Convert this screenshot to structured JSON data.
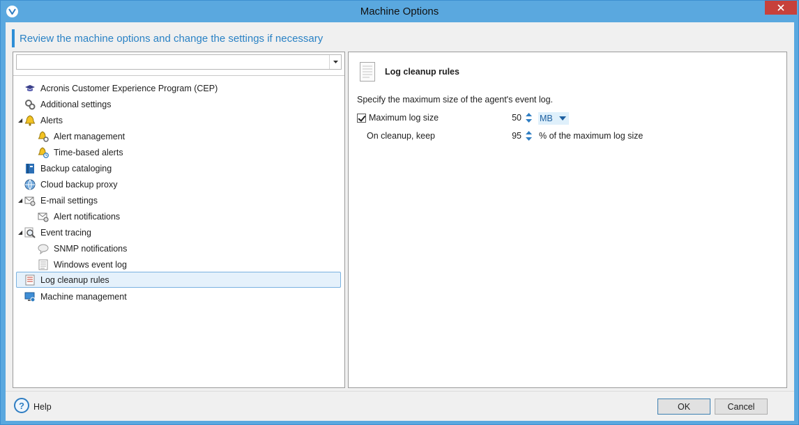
{
  "window": {
    "title": "Machine Options"
  },
  "header": {
    "text": "Review the machine options and change the settings if necessary"
  },
  "filter": {
    "value": ""
  },
  "tree": {
    "items": [
      {
        "label": "Acronis Customer Experience Program (CEP)",
        "icon": "graduation-cap-icon"
      },
      {
        "label": "Additional settings",
        "icon": "gears-icon"
      },
      {
        "label": "Alerts",
        "icon": "bell-icon"
      },
      {
        "label": "Alert management",
        "icon": "alert-management-icon"
      },
      {
        "label": "Time-based alerts",
        "icon": "time-alert-icon"
      },
      {
        "label": "Backup cataloging",
        "icon": "catalog-book-icon"
      },
      {
        "label": "Cloud backup proxy",
        "icon": "globe-icon"
      },
      {
        "label": "E-mail settings",
        "icon": "email-gear-icon"
      },
      {
        "label": "Alert notifications",
        "icon": "email-gear-icon"
      },
      {
        "label": "Event tracing",
        "icon": "magnifier-icon"
      },
      {
        "label": "SNMP notifications",
        "icon": "speech-bubble-icon"
      },
      {
        "label": "Windows event log",
        "icon": "document-icon"
      },
      {
        "label": "Log cleanup rules",
        "icon": "log-list-icon"
      },
      {
        "label": "Machine management",
        "icon": "monitor-icon"
      }
    ],
    "selected": "Log cleanup rules"
  },
  "panel": {
    "title": "Log cleanup rules",
    "description": "Specify the maximum size of the agent's event log.",
    "max_log_size_label": "Maximum log size",
    "max_log_size_checked": true,
    "max_log_size_value": "50",
    "max_log_size_unit": "MB",
    "keep_label": "On cleanup, keep",
    "keep_value": "95",
    "keep_suffix": "% of the maximum log size"
  },
  "footer": {
    "help_label": "Help",
    "ok_label": "OK",
    "cancel_label": "Cancel"
  },
  "colors": {
    "titlebar": "#5aa8df",
    "accent": "#2a82c5",
    "close": "#c7413b",
    "selection": "#e5f1fb"
  }
}
